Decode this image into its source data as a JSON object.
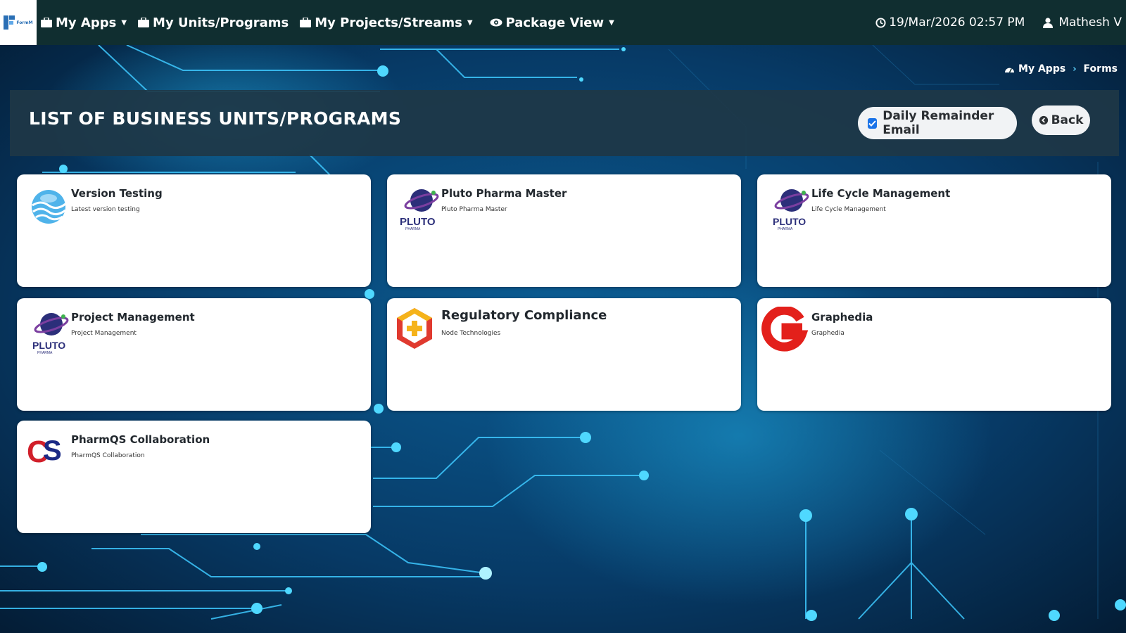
{
  "app": {
    "logo_text": "FormM",
    "nav": [
      {
        "label": "My Apps",
        "icon": "briefcase-icon",
        "dropdown": true
      },
      {
        "label": "My Units/Programs",
        "icon": "briefcase-icon",
        "dropdown": false
      },
      {
        "label": "My Projects/Streams",
        "icon": "briefcase-icon",
        "dropdown": true
      },
      {
        "label": "Package View",
        "icon": "eye-icon",
        "dropdown": true
      }
    ],
    "datetime": "19/Mar/2026 02:57 PM",
    "user": "Mathesh V"
  },
  "breadcrumb": {
    "home": "My Apps",
    "current": "Forms"
  },
  "header": {
    "title": "LIST OF BUSINESS UNITS/PROGRAMS",
    "reminder_label": "Daily Remainder Email",
    "reminder_checked": true,
    "back_label": "Back"
  },
  "cards": [
    {
      "title": "Version Testing",
      "subtitle": "Latest version testing",
      "logo": "water-waves-logo"
    },
    {
      "title": "Pluto Pharma Master",
      "subtitle": "Pluto Pharma Master",
      "logo": "pluto-pharma-logo"
    },
    {
      "title": "Life Cycle Management",
      "subtitle": "Life Cycle Management",
      "logo": "pluto-pharma-logo"
    },
    {
      "title": "Project Management",
      "subtitle": "Project Management",
      "logo": "pluto-pharma-logo"
    },
    {
      "title": "Regulatory Compliance",
      "subtitle": "Node Technologies",
      "logo": "hexagon-plus-logo"
    },
    {
      "title": "Graphedia",
      "subtitle": "Graphedia",
      "logo": "graphedia-g-logo"
    },
    {
      "title": "PharmQS Collaboration",
      "subtitle": "PharmQS Collaboration",
      "logo": "qs-logo"
    }
  ],
  "colors": {
    "navbar": "#102e30",
    "header_panel": "#1e3746",
    "accent": "#1a73e8",
    "circuit": "#3ec9ff"
  }
}
